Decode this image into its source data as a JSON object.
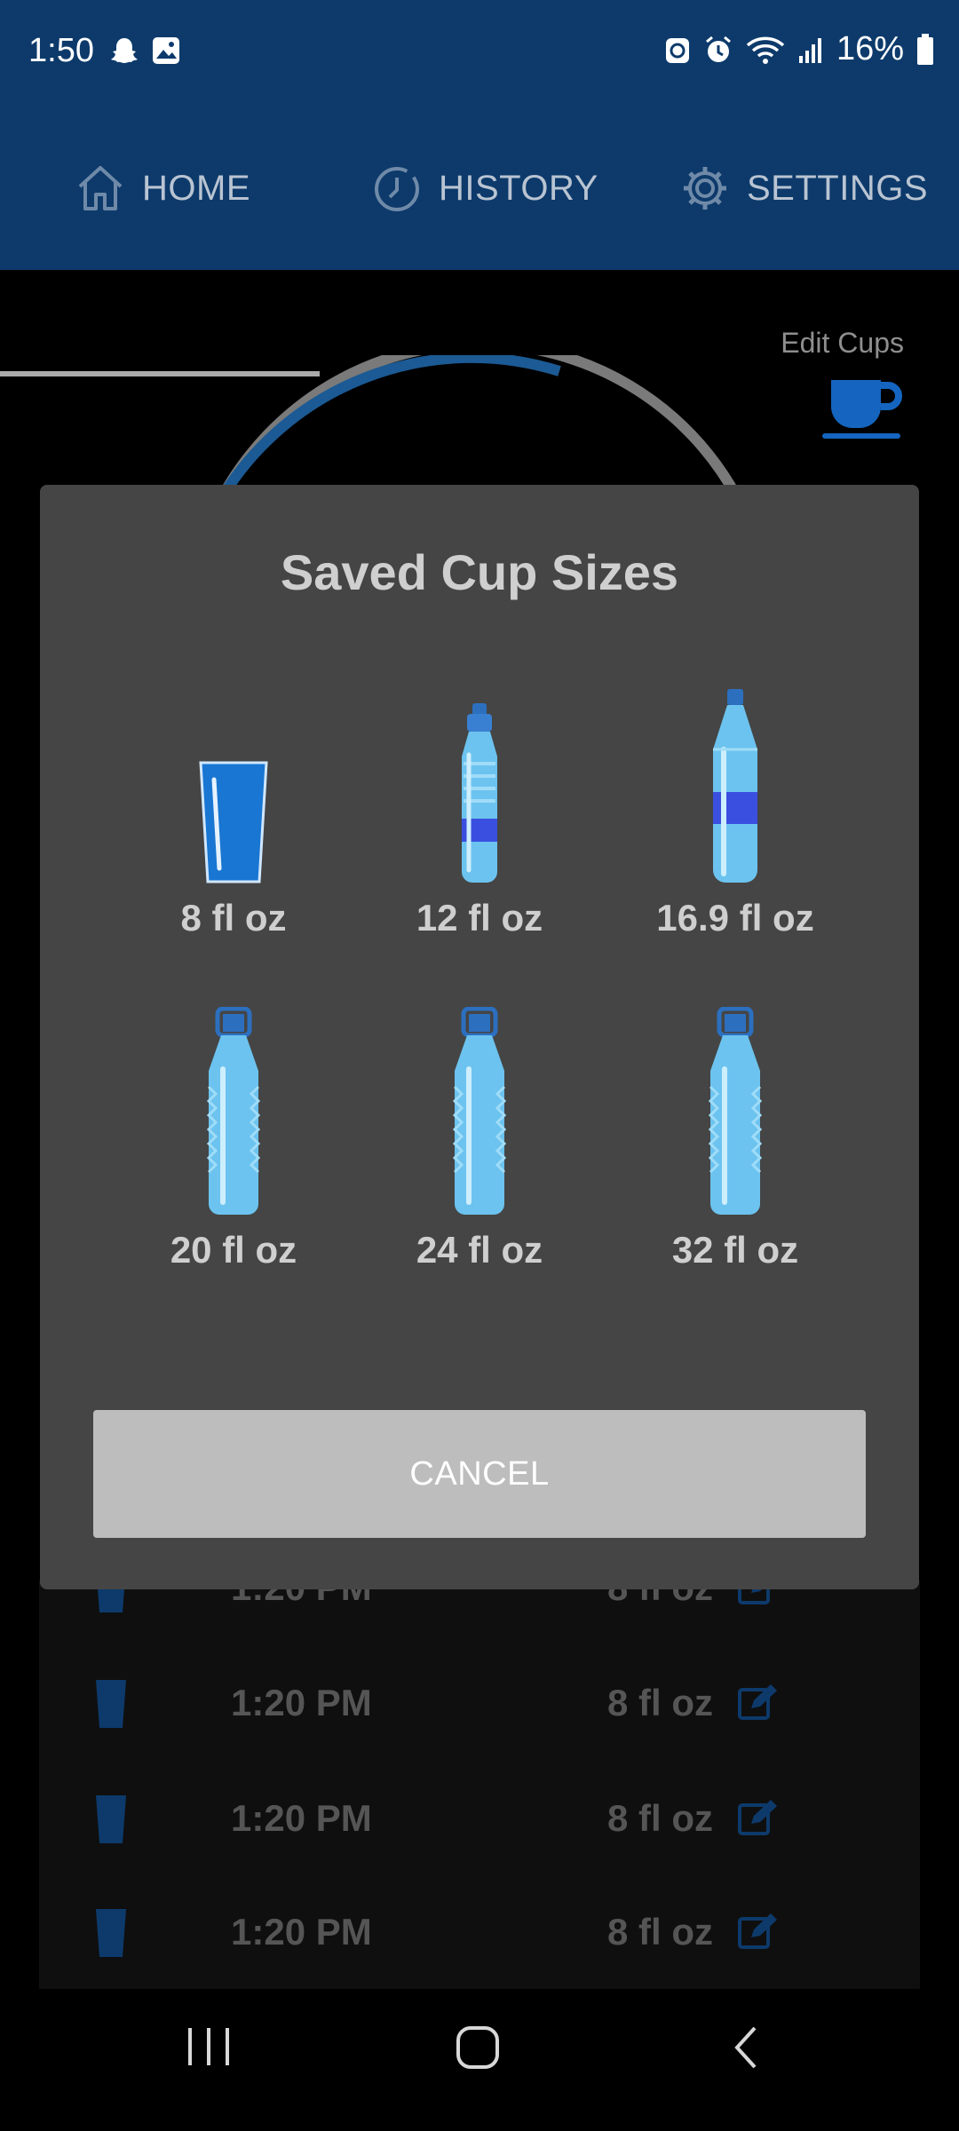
{
  "status_bar": {
    "time": "1:50",
    "battery": "16%",
    "icons": [
      "snapchat-icon",
      "gallery-icon",
      "sync-icon",
      "alarm-icon",
      "wifi-icon",
      "signal-icon",
      "battery-icon"
    ]
  },
  "tabs": [
    {
      "label": "HOME",
      "icon": "home-icon",
      "selected": true
    },
    {
      "label": "HISTORY",
      "icon": "history-icon",
      "selected": false
    },
    {
      "label": "SETTINGS",
      "icon": "gear-icon",
      "selected": false
    }
  ],
  "home": {
    "edit_cups_label": "Edit Cups",
    "progress_fraction": 0.1
  },
  "dialog": {
    "title": "Saved Cup Sizes",
    "cups": [
      {
        "label": "8 fl oz",
        "icon": "glass-icon"
      },
      {
        "label": "12 fl oz",
        "icon": "sport-bottle-icon"
      },
      {
        "label": "16.9 fl oz",
        "icon": "tall-bottle-icon"
      },
      {
        "label": "20 fl oz",
        "icon": "large-bottle-icon"
      },
      {
        "label": "24 fl oz",
        "icon": "large-bottle-icon"
      },
      {
        "label": "32 fl oz",
        "icon": "large-bottle-icon"
      }
    ],
    "cancel_label": "CANCEL"
  },
  "history_rows": [
    {
      "time": "1:20 PM",
      "amount": "8 fl oz"
    },
    {
      "time": "1:20 PM",
      "amount": "8 fl oz"
    },
    {
      "time": "1:20 PM",
      "amount": "8 fl oz"
    },
    {
      "time": "1:20 PM",
      "amount": "8 fl oz"
    }
  ],
  "colors": {
    "header": "#0d3a6b",
    "accent": "#1565c0",
    "dialog_bg": "#454545",
    "button": "#bdbdbd"
  }
}
